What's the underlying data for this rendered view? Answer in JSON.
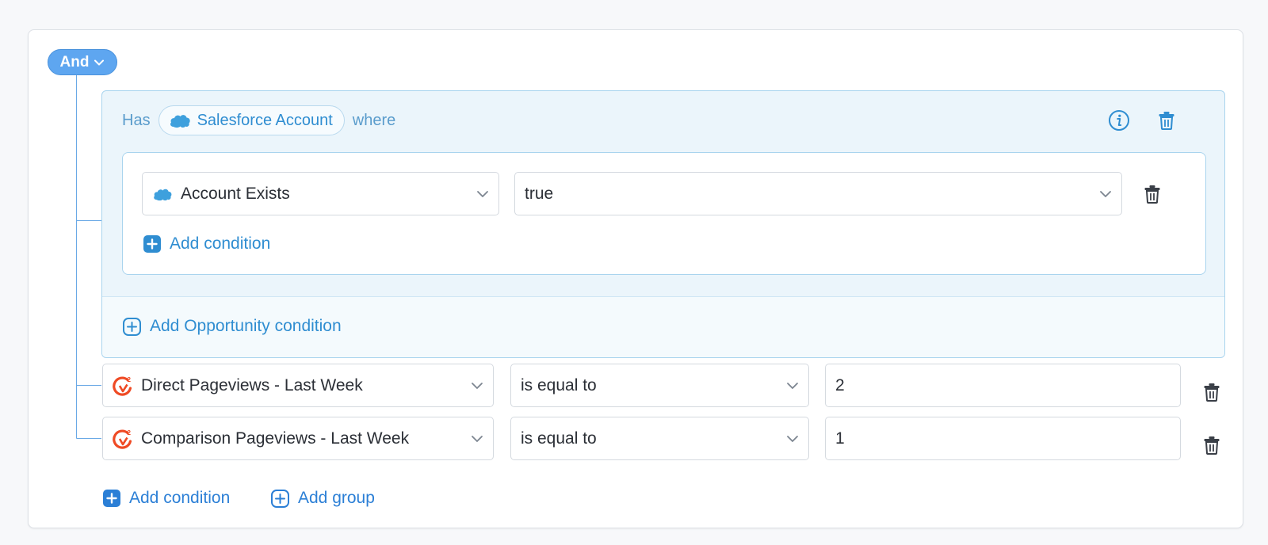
{
  "root": {
    "operator_label": "And"
  },
  "group": {
    "has_label": "Has",
    "object_label": "Salesforce Account",
    "where_label": "where",
    "condition": {
      "field": "Account Exists",
      "value": "true"
    },
    "add_condition_label": "Add condition",
    "add_opportunity_label": "Add Opportunity condition"
  },
  "conditions": [
    {
      "field": "Direct Pageviews - Last Week",
      "operator": "is equal to",
      "value": "2"
    },
    {
      "field": "Comparison Pageviews - Last Week",
      "operator": "is equal to",
      "value": "1"
    }
  ],
  "footer": {
    "add_condition_label": "Add condition",
    "add_group_label": "Add group"
  },
  "icons": {
    "salesforce": "salesforce-cloud-icon",
    "g2": "g2-logo-icon",
    "info": "info-icon",
    "trash": "trash-icon",
    "plus": "plus-icon",
    "chevron": "chevron-down-icon"
  },
  "colors": {
    "accent": "#2f8dd1",
    "pill": "#5ea6f0",
    "g2": "#ef4a24",
    "group_bg": "#ebf5fb"
  }
}
